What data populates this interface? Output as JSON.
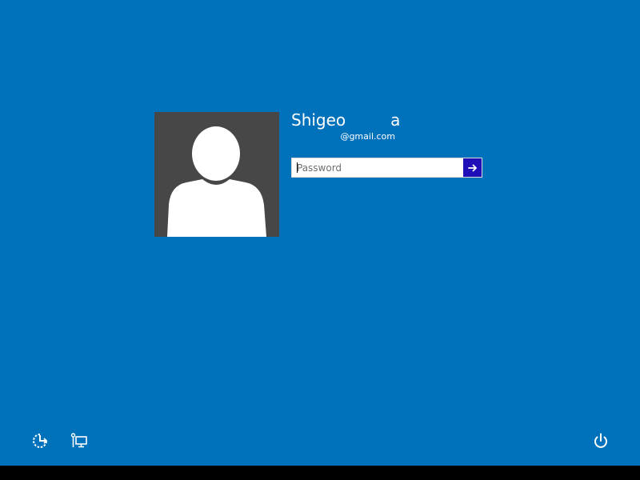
{
  "user": {
    "name_first": "Shigeo",
    "name_last_visible": "a",
    "email_suffix": "@gmail.com"
  },
  "password": {
    "placeholder": "Password",
    "value": "",
    "submit_icon": "arrow-right-icon"
  },
  "bottom_bar": {
    "left_icons": [
      "ease-of-access-icon",
      "network-icon"
    ],
    "right_icons": [
      "power-icon"
    ]
  },
  "colors": {
    "background": "#0072BC",
    "avatar_bg": "#474747",
    "submit_bg": "#1F0FB8",
    "text": "#FFFFFF"
  }
}
